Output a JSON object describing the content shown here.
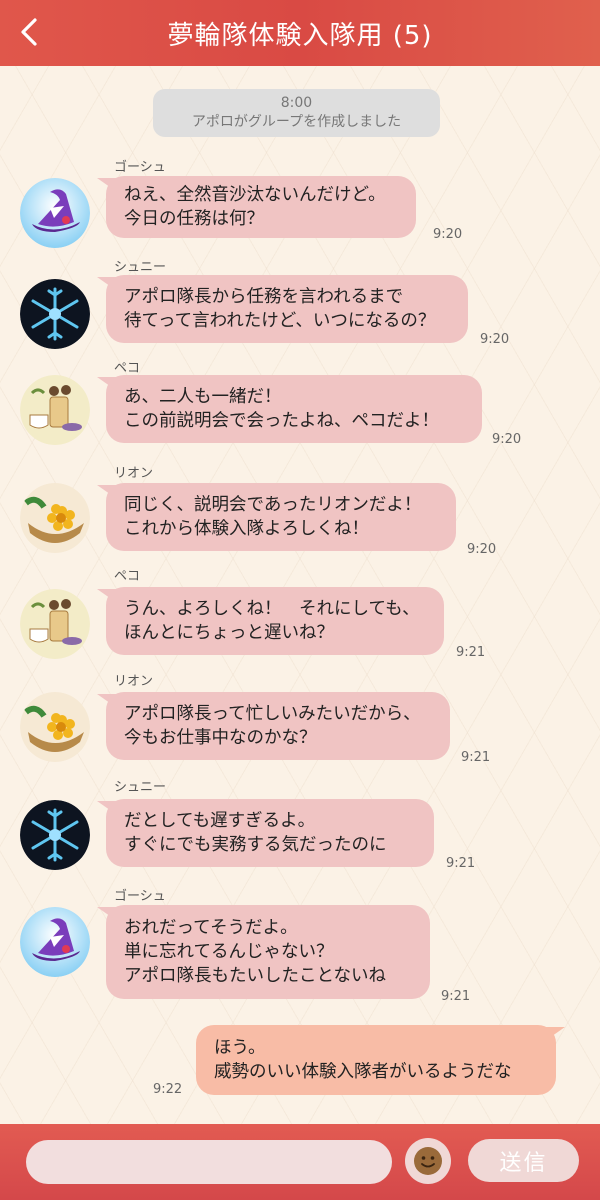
{
  "header": {
    "title": "夢輪隊体験入隊用 (5)",
    "back_icon": "chevron-left-icon"
  },
  "system_message": {
    "time": "8:00",
    "text": "アポロがグループを作成しました"
  },
  "messages": [
    {
      "sender": "ゴーシュ",
      "avatar": "wizard-hat-icon",
      "lines": [
        "ねえ、全然音沙汰ないんだけど。",
        "今日の任務は何？"
      ],
      "time": "9:20"
    },
    {
      "sender": "シュニー",
      "avatar": "snowflake-icon",
      "lines": [
        "アポロ隊長から任務を言われるまで",
        "待てって言われたけど、いつになるの？"
      ],
      "time": "9:20"
    },
    {
      "sender": "ペコ",
      "avatar": "tea-set-icon",
      "lines": [
        "あ、二人も一緒だ！",
        "この前説明会で会ったよね、ペコだよ！"
      ],
      "time": "9:20"
    },
    {
      "sender": "リオン",
      "avatar": "flower-bowl-icon",
      "lines": [
        "同じく、説明会であったリオンだよ！",
        "これから体験入隊よろしくね！"
      ],
      "time": "9:20"
    },
    {
      "sender": "ペコ",
      "avatar": "tea-set-icon",
      "lines": [
        "うん、よろしくね！　それにしても、",
        "ほんとにちょっと遅いね？"
      ],
      "time": "9:21"
    },
    {
      "sender": "リオン",
      "avatar": "flower-bowl-icon",
      "lines": [
        "アポロ隊長って忙しいみたいだから、",
        "今もお仕事中なのかな？"
      ],
      "time": "9:21"
    },
    {
      "sender": "シュニー",
      "avatar": "snowflake-icon",
      "lines": [
        "だとしても遅すぎるよ。",
        "すぐにでも実務する気だったのに"
      ],
      "time": "9:21"
    },
    {
      "sender": "ゴーシュ",
      "avatar": "wizard-hat-icon",
      "lines": [
        "おれだってそうだよ。",
        "単に忘れてるんじゃない？",
        "アポロ隊長もたいしたことないね"
      ],
      "time": "9:21"
    }
  ],
  "own_message": {
    "lines": [
      "ほう。",
      "威勢のいい体験入隊者がいるようだな"
    ],
    "time": "9:22"
  },
  "footer": {
    "input_value": "",
    "emoji_icon": "smiley-face-icon",
    "send_label": "送信"
  },
  "colors": {
    "header": "#d94a44",
    "bubble_left": "#f0c4c3",
    "bubble_right": "#f8bca6",
    "background": "#fbf2e6"
  }
}
